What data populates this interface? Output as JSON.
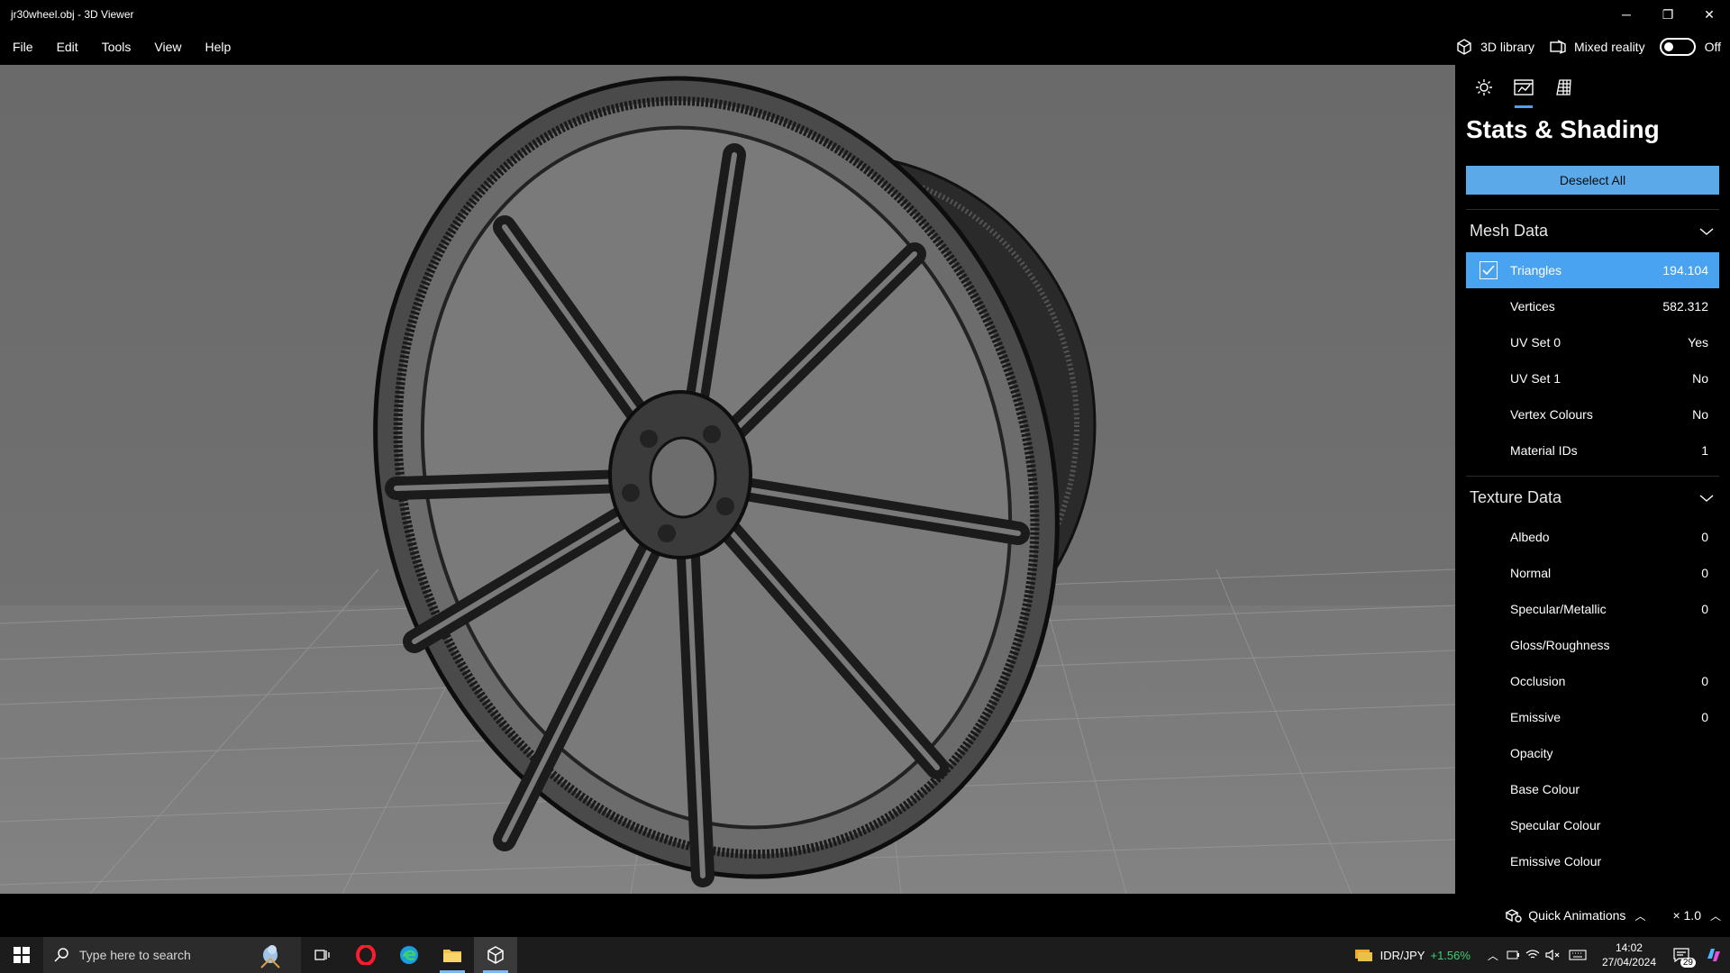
{
  "window": {
    "title": "jr30wheel.obj - 3D Viewer",
    "controls": {
      "minimize": "─",
      "restore": "❐",
      "close": "✕"
    }
  },
  "menu": {
    "items": [
      "File",
      "Edit",
      "Tools",
      "View",
      "Help"
    ],
    "library_label": "3D library",
    "mixed_reality_label": "Mixed reality",
    "toggle_state": "Off"
  },
  "panel": {
    "tab_icons": [
      "sun-icon",
      "stats-icon",
      "grid-icon"
    ],
    "title": "Stats & Shading",
    "deselect_label": "Deselect All",
    "mesh_header": "Mesh Data",
    "mesh_rows": [
      {
        "label": "Triangles",
        "value": "194.104",
        "selected": true
      },
      {
        "label": "Vertices",
        "value": "582.312"
      },
      {
        "label": "UV Set 0",
        "value": "Yes"
      },
      {
        "label": "UV Set 1",
        "value": "No"
      },
      {
        "label": "Vertex Colours",
        "value": "No"
      },
      {
        "label": "Material IDs",
        "value": "1"
      }
    ],
    "texture_header": "Texture Data",
    "texture_rows": [
      {
        "label": "Albedo",
        "value": "0"
      },
      {
        "label": "Normal",
        "value": "0"
      },
      {
        "label": "Specular/Metallic",
        "value": "0"
      },
      {
        "label": "Gloss/Roughness",
        "value": ""
      },
      {
        "label": "Occlusion",
        "value": "0"
      },
      {
        "label": "Emissive",
        "value": "0"
      },
      {
        "label": "Opacity",
        "value": ""
      },
      {
        "label": "Base Colour",
        "value": ""
      },
      {
        "label": "Specular Colour",
        "value": ""
      },
      {
        "label": "Emissive Colour",
        "value": ""
      }
    ]
  },
  "status": {
    "quick_animations": "Quick Animations",
    "speed": "× 1.0"
  },
  "taskbar": {
    "search_placeholder": "Type here to search",
    "ticker_symbol": "IDR/JPY",
    "ticker_change": "+1.56%",
    "time": "14:02",
    "date": "27/04/2024",
    "notification_count": "29"
  },
  "colors": {
    "accent": "#4aa3f0",
    "button": "#5ca9ea",
    "ticker_up": "#3cd070",
    "viewport_bg": "#6e6e6e"
  }
}
